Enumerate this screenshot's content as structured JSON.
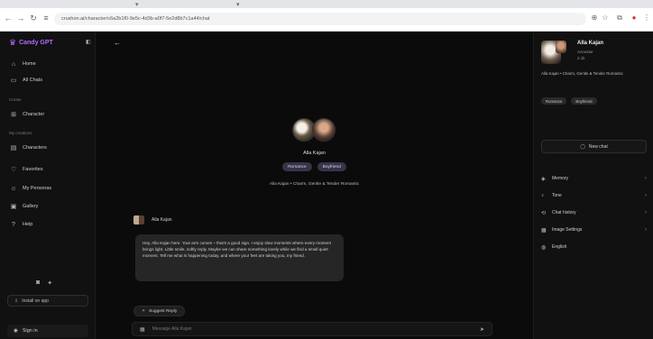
{
  "browser": {
    "url": "crushon.ai/character/c6a2b1f0-9e5c-4d3b-a0f7-5e2d8b7c1a44/chat",
    "back_icon": "back-arrow-icon",
    "forward_icon": "forward-arrow-icon",
    "reload_icon": "reload-icon"
  },
  "sidebar": {
    "logo_text": "Candy GPT",
    "items": [
      {
        "label": "Home",
        "icon": "home-icon"
      },
      {
        "label": "All Chats",
        "icon": "chat-icon"
      }
    ],
    "section_create": "Create",
    "create_items": [
      {
        "label": "Character",
        "icon": "character-icon"
      }
    ],
    "section_my": "My creations",
    "my_items": [
      {
        "label": "Characters",
        "icon": "folder-icon"
      }
    ],
    "more_items": [
      {
        "label": "Favorites",
        "icon": "heart-icon"
      },
      {
        "label": "My Personas",
        "icon": "persona-icon"
      },
      {
        "label": "Gallery",
        "icon": "gallery-icon"
      },
      {
        "label": "Help",
        "icon": "help-icon"
      }
    ],
    "download_label": "Install on app",
    "signin_label": "Sign in"
  },
  "main": {
    "character_name": "Alla Kajan",
    "tags": [
      "Romance",
      "Boyfriend"
    ],
    "tagline": "Alla Kajan • Charm, Gentle & Tender Romantic",
    "message": {
      "author": "Alla Kajan",
      "text": "Hey, Alla Kajan here. Your arm curves – that's a good sign. I enjoy slow moments where every moment brings light. Little smile, softly reply. Maybe we can share something lovely while we find a small quiet moment. Tell me what is happening today, and where your feet are taking you, my friend."
    },
    "suggest_label": "Suggest Reply",
    "composer_placeholder": "Message Alla Kajan"
  },
  "right": {
    "name": "Alla Kajan",
    "sub1": "Ancestor",
    "sub2": "2.1k",
    "description": "Alla Kajan • Charm, Gentle & Tender Romantic",
    "tags": [
      "Romance",
      "Boyfriend"
    ],
    "new_chat_label": "New chat",
    "menu": [
      {
        "label": "Memory",
        "icon": "memory-icon"
      },
      {
        "label": "Tone",
        "icon": "tone-icon"
      },
      {
        "label": "Chat history",
        "icon": "history-icon"
      },
      {
        "label": "Image Settings",
        "icon": "image-icon"
      },
      {
        "label": "English",
        "icon": "globe-icon"
      }
    ]
  }
}
